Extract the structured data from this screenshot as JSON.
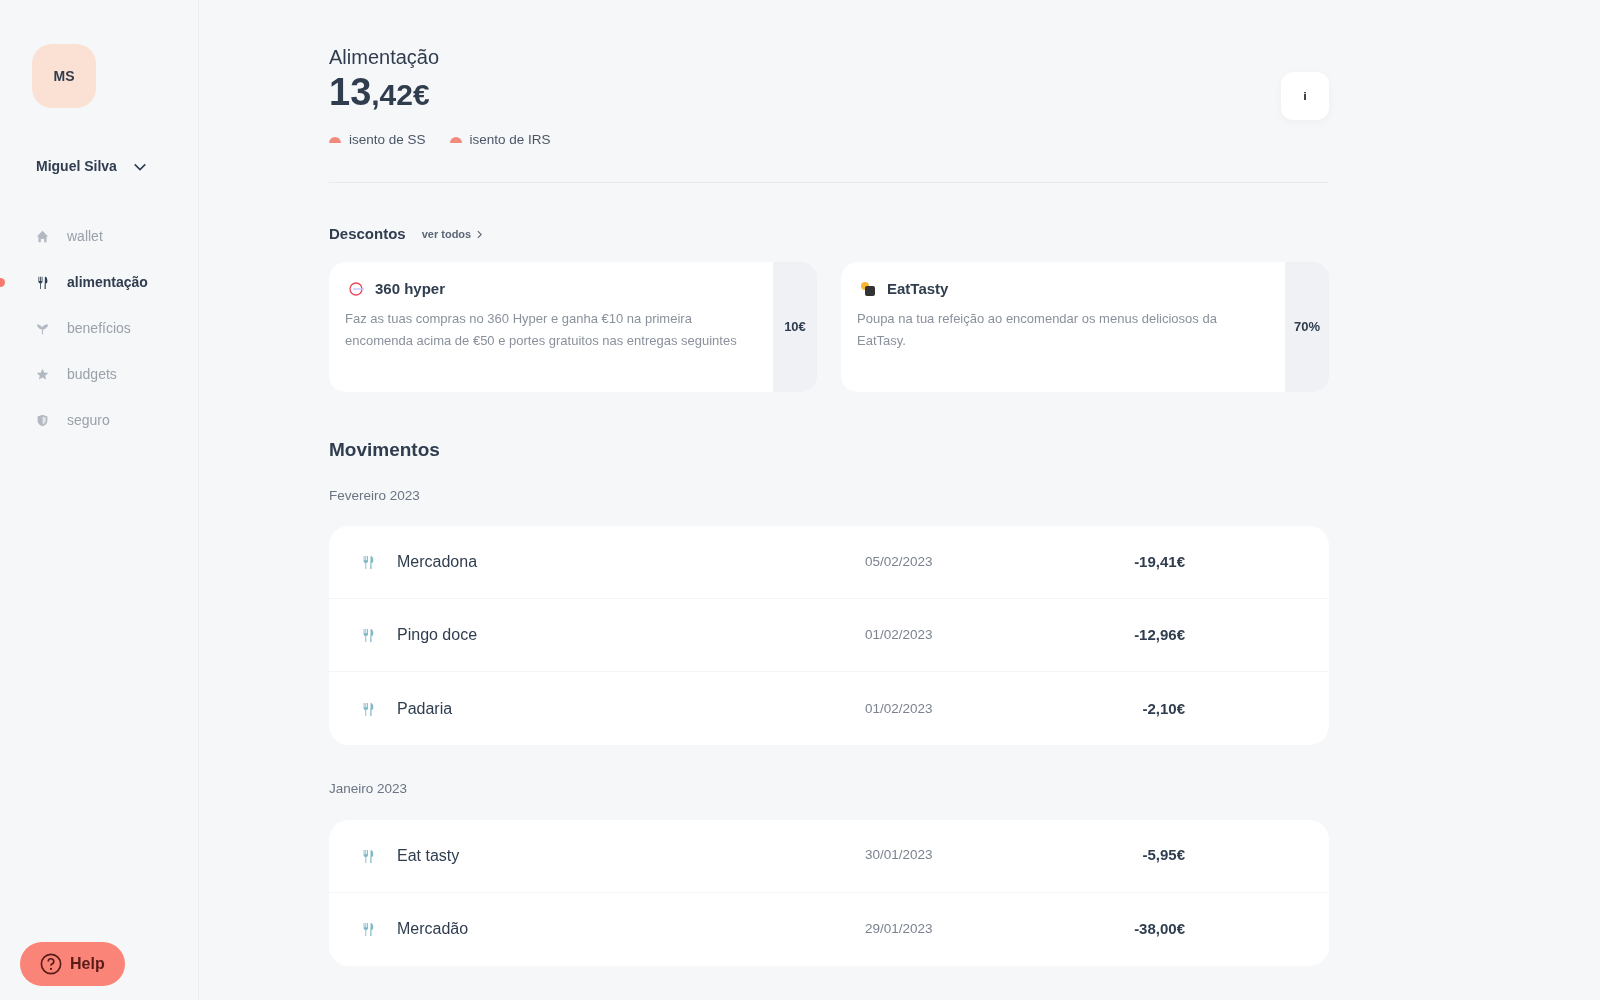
{
  "sidebar": {
    "avatar": "MS",
    "user": "Miguel Silva",
    "items": [
      {
        "label": "wallet",
        "selected": false
      },
      {
        "label": "alimentação",
        "selected": true
      },
      {
        "label": "benefícios",
        "selected": false
      },
      {
        "label": "budgets",
        "selected": false
      },
      {
        "label": "seguro",
        "selected": false
      }
    ],
    "help": "Help"
  },
  "header": {
    "title": "Alimentação",
    "amount_whole": "13",
    "amount_cents": ",42€",
    "tags": [
      "isento de SS",
      "isento de IRS"
    ],
    "info": "i"
  },
  "discounts": {
    "title": "Descontos",
    "link": "ver todos",
    "cards": [
      {
        "name": "360 hyper",
        "text": "Faz as tuas compras no 360 Hyper e ganha €10 na primeira encomenda acima de €50 e portes gratuitos nas entregas seguintes",
        "value": "10€"
      },
      {
        "name": "EatTasty",
        "text": "Poupa na tua refeição ao encomendar os menus deliciosos da EatTasy.",
        "value": "70%"
      }
    ]
  },
  "movements": {
    "title": "Movimentos",
    "groups": [
      {
        "month": "Fevereiro 2023",
        "rows": [
          {
            "name": "Mercadona",
            "date": "05/02/2023",
            "amount": "-19,41€"
          },
          {
            "name": "Pingo doce",
            "date": "01/02/2023",
            "amount": "-12,96€"
          },
          {
            "name": "Padaria",
            "date": "01/02/2023",
            "amount": "-2,10€"
          }
        ]
      },
      {
        "month": "Janeiro 2023",
        "rows": [
          {
            "name": "Eat tasty",
            "date": "30/01/2023",
            "amount": "-5,95€"
          },
          {
            "name": "Mercadão",
            "date": "29/01/2023",
            "amount": "-38,00€"
          }
        ]
      }
    ]
  }
}
